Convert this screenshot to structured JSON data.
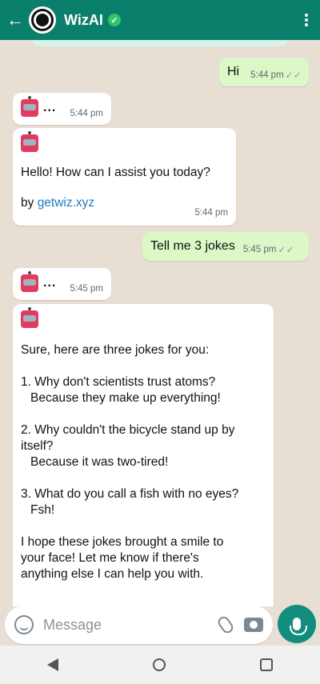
{
  "header": {
    "title": "WizAI",
    "back_icon": "arrow-left-icon",
    "avatar_icon": "wizai-logo-icon",
    "verified_icon": "verified-check-icon",
    "menu_icon": "more-vertical-icon",
    "bg_color": "#0a7f6b"
  },
  "messages": [
    {
      "from": "user",
      "text": "Hi",
      "time": "5:44 pm",
      "status": "read"
    },
    {
      "from": "bot",
      "type": "typing",
      "text": "...",
      "time": "5:44 pm"
    },
    {
      "from": "bot",
      "text": "Hello! How can I assist you today?",
      "by_label": "by",
      "link": "getwiz.xyz",
      "time": "5:44 pm"
    },
    {
      "from": "user",
      "text": "Tell me 3 jokes",
      "time": "5:45 pm",
      "status": "read"
    },
    {
      "from": "bot",
      "type": "typing",
      "text": "...",
      "time": "5:45 pm"
    },
    {
      "from": "bot",
      "intro": "Sure, here are three jokes for you:",
      "jokes": [
        {
          "q": "1. Why don't scientists trust atoms?",
          "a": "Because they make up everything!"
        },
        {
          "q": "2. Why couldn't the bicycle stand up by itself?",
          "a": "Because it was two-tired!"
        },
        {
          "q": "3. What do you call a fish with no eyes?",
          "a": "Fsh!"
        }
      ],
      "outro": "I hope these jokes brought a smile to your face! Let me know if there's anything else I can help you with."
    }
  ],
  "composer": {
    "placeholder": "Message",
    "emoji_icon": "emoji-icon",
    "attach_icon": "paperclip-icon",
    "camera_icon": "camera-icon",
    "mic_icon": "microphone-icon"
  },
  "navbar": {
    "back_icon": "nav-back-icon",
    "home_icon": "nav-home-icon",
    "recents_icon": "nav-recents-icon"
  }
}
